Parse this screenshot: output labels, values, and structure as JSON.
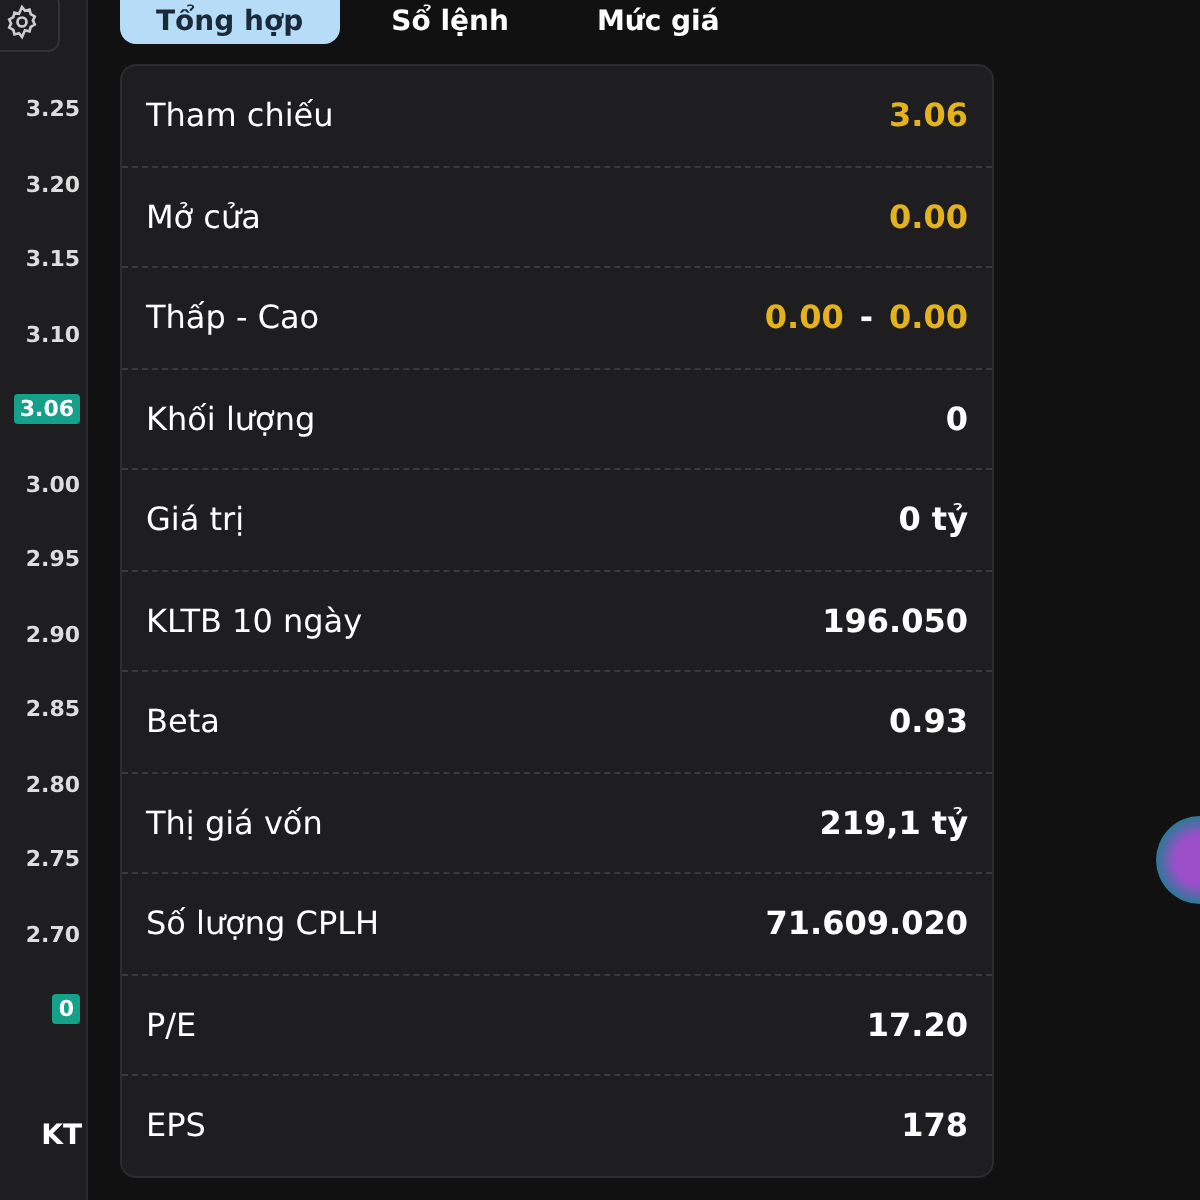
{
  "tabs": [
    {
      "label": "Tổng hợp",
      "selected": true
    },
    {
      "label": "Sổ lệnh",
      "selected": false
    },
    {
      "label": "Mức giá",
      "selected": false
    }
  ],
  "price_axis": [
    {
      "label": "3.25",
      "kind": "tick"
    },
    {
      "label": "3.20",
      "kind": "tick"
    },
    {
      "label": "3.15",
      "kind": "tick"
    },
    {
      "label": "3.10",
      "kind": "tick"
    },
    {
      "label": "3.06",
      "kind": "current"
    },
    {
      "label": "3.00",
      "kind": "tick"
    },
    {
      "label": "2.95",
      "kind": "tick"
    },
    {
      "label": "2.90",
      "kind": "tick"
    },
    {
      "label": "2.85",
      "kind": "tick"
    },
    {
      "label": "2.80",
      "kind": "tick"
    },
    {
      "label": "2.75",
      "kind": "tick"
    },
    {
      "label": "2.70",
      "kind": "tick"
    },
    {
      "label": "0",
      "kind": "current"
    }
  ],
  "axis_footer": "KT",
  "summary": [
    {
      "label": "Tham chiếu",
      "kind": "price",
      "values": [
        "3.06"
      ]
    },
    {
      "label": "Mở cửa",
      "kind": "price",
      "values": [
        "0.00"
      ]
    },
    {
      "label": "Thấp - Cao",
      "kind": "price",
      "values": [
        "0.00",
        "0.00"
      ],
      "separator": "-"
    },
    {
      "label": "Khối lượng",
      "kind": "plain",
      "values": [
        "0"
      ]
    },
    {
      "label": "Giá trị",
      "kind": "plain",
      "values": [
        "0 tỷ"
      ]
    },
    {
      "label": "KLTB 10 ngày",
      "kind": "plain",
      "values": [
        "196.050"
      ]
    },
    {
      "label": "Beta",
      "kind": "plain",
      "values": [
        "0.93"
      ]
    },
    {
      "label": "Thị giá vốn",
      "kind": "plain",
      "values": [
        "219,1 tỷ"
      ]
    },
    {
      "label": "Số lượng CPLH",
      "kind": "plain",
      "values": [
        "71.609.020"
      ]
    },
    {
      "label": "P/E",
      "kind": "plain",
      "values": [
        "17.20"
      ]
    },
    {
      "label": "EPS",
      "kind": "plain",
      "values": [
        "178"
      ]
    }
  ]
}
